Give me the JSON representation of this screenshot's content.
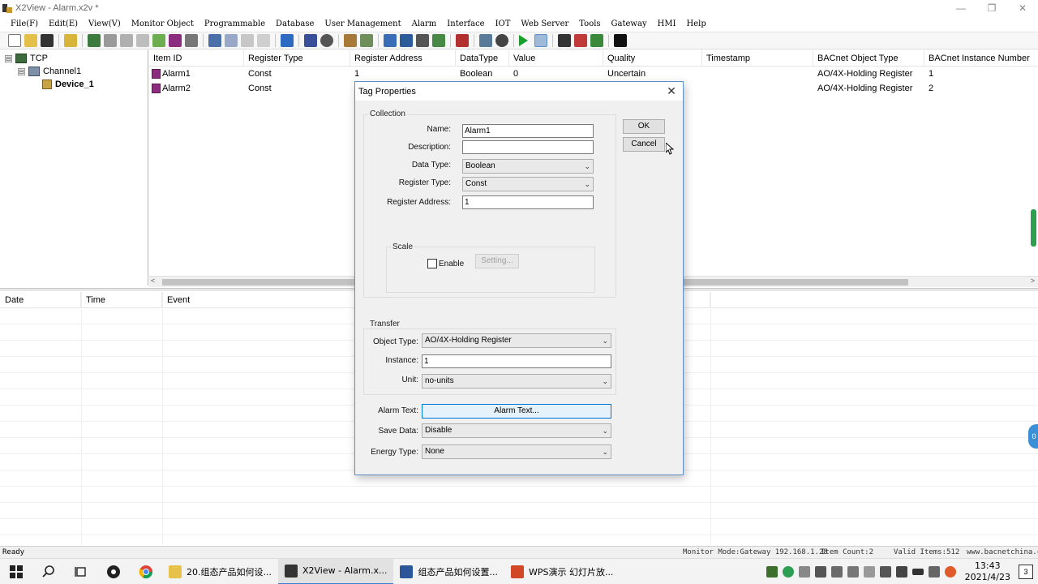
{
  "window": {
    "title": "X2View - Alarm.x2v *",
    "controls": [
      "—",
      "❐",
      "✕"
    ]
  },
  "menu": [
    "File(F)",
    "Edit(E)",
    "View(V)",
    "Monitor Object",
    "Programmable",
    "Database",
    "User Management",
    "Alarm",
    "Interface",
    "IOT",
    "Web Server",
    "Tools",
    "Gateway",
    "HMI",
    "Help"
  ],
  "tree": {
    "root": "TCP",
    "channel": "Channel1",
    "device": "Device_1",
    "toggles": [
      "⊟",
      "⊟"
    ]
  },
  "grid": {
    "columns": [
      "Item ID",
      "Register Type",
      "Register Address",
      "DataType",
      "Value",
      "Quality",
      "Timestamp",
      "BACnet Object Type",
      "BACnet Instance Number"
    ],
    "rows": [
      [
        "Alarm1",
        "Const",
        "1",
        "Boolean",
        "0",
        "Uncertain",
        "",
        "AO/4X-Holding Register",
        "1"
      ],
      [
        "Alarm2",
        "Const",
        "",
        "",
        "",
        "",
        "",
        "AO/4X-Holding Register",
        "2"
      ]
    ]
  },
  "scroll_arrows": {
    "left": "<",
    "right": ">"
  },
  "eventlog": {
    "columns": [
      "Date",
      "Time",
      "Event"
    ]
  },
  "dialog": {
    "title": "Tag Properties",
    "close": "✕",
    "collection_label": "Collection",
    "name_label": "Name:",
    "name_value": "Alarm1",
    "description_label": "Description:",
    "description_value": "",
    "datatype_label": "Data Type:",
    "datatype_value": "Boolean",
    "regtype_label": "Register Type:",
    "regtype_value": "Const",
    "regaddr_label": "Register Address:",
    "regaddr_value": "1",
    "scale_label": "Scale",
    "enable_label": "Enable",
    "setting_label": "Setting...",
    "ok": "OK",
    "cancel": "Cancel",
    "transfer_label": "Transfer",
    "objtype_label": "Object Type:",
    "objtype_value": "AO/4X-Holding Register",
    "instance_label": "Instance:",
    "instance_value": "1",
    "unit_label": "Unit:",
    "unit_value": "no-units",
    "alarmtext_label": "Alarm Text:",
    "alarmtext_button": "Alarm Text...",
    "savedata_label": "Save Data:",
    "savedata_value": "Disable",
    "energytype_label": "Energy Type:",
    "energytype_value": "None",
    "chevron": "⌄"
  },
  "status": {
    "ready": "Ready",
    "monitor": "Monitor Mode:Gateway 192.168.1.28",
    "count": "Item Count:2",
    "valid": "Valid Items:512",
    "site": "www.bacnetchina.com"
  },
  "taskbar": {
    "tasks": [
      "20.组态产品如何设...",
      "X2View - Alarm.x...",
      "组态产品如何设置...",
      "WPS演示 幻灯片放..."
    ],
    "time": "13:43",
    "date": "2021/4/23",
    "notifications": "3"
  },
  "side_badge": "0",
  "colors": {
    "accent": "#0078d7",
    "tag_icon": "#8b2c7e",
    "scroll_thumb_green": "#2e9e52"
  }
}
